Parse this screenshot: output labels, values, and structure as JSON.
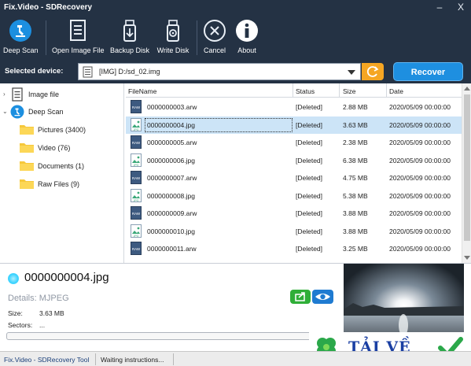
{
  "window": {
    "title": "Fix.Video - SDRecovery",
    "minimize": "–",
    "close": "X"
  },
  "toolbar": {
    "items": [
      {
        "label": "Deep Scan",
        "icon": "deep-scan-icon"
      },
      {
        "label": "Open Image File",
        "icon": "open-image-file-icon"
      },
      {
        "label": "Backup Disk",
        "icon": "backup-disk-icon"
      },
      {
        "label": "Write Disk",
        "icon": "write-disk-icon"
      },
      {
        "label": "Cancel",
        "icon": "cancel-icon"
      },
      {
        "label": "About",
        "icon": "about-icon"
      }
    ]
  },
  "device_bar": {
    "label": "Selected device:",
    "selected": "[IMG] D:/sd_02.img",
    "recover_label": "Recover"
  },
  "tree": {
    "root": [
      {
        "label": "Image file",
        "icon": "image-file-icon"
      },
      {
        "label": "Deep Scan",
        "icon": "deep-scan-icon"
      }
    ],
    "children": [
      {
        "label": "Pictures (3400)",
        "icon": "folder-icon"
      },
      {
        "label": "Video (76)",
        "icon": "folder-icon"
      },
      {
        "label": "Documents (1)",
        "icon": "folder-icon"
      },
      {
        "label": "Raw Files (9)",
        "icon": "folder-icon"
      }
    ]
  },
  "table": {
    "columns": [
      "FileName",
      "Status",
      "Size",
      "Date"
    ],
    "rows": [
      {
        "name": "0000000003.arw",
        "status": "[Deleted]",
        "size": "2.88 MB",
        "date": "2020/05/09 00:00:00",
        "type": "RAW"
      },
      {
        "name": "0000000004.jpg",
        "status": "[Deleted]",
        "size": "3.63 MB",
        "date": "2020/05/09 00:00:00",
        "type": "JPG",
        "selected": true
      },
      {
        "name": "0000000005.arw",
        "status": "[Deleted]",
        "size": "2.38 MB",
        "date": "2020/05/09 00:00:00",
        "type": "RAW"
      },
      {
        "name": "0000000006.jpg",
        "status": "[Deleted]",
        "size": "6.38 MB",
        "date": "2020/05/09 00:00:00",
        "type": "JPG"
      },
      {
        "name": "0000000007.arw",
        "status": "[Deleted]",
        "size": "4.75 MB",
        "date": "2020/05/09 00:00:00",
        "type": "RAW"
      },
      {
        "name": "0000000008.jpg",
        "status": "[Deleted]",
        "size": "5.38 MB",
        "date": "2020/05/09 00:00:00",
        "type": "JPG"
      },
      {
        "name": "0000000009.arw",
        "status": "[Deleted]",
        "size": "3.88 MB",
        "date": "2020/05/09 00:00:00",
        "type": "RAW"
      },
      {
        "name": "0000000010.jpg",
        "status": "[Deleted]",
        "size": "3.88 MB",
        "date": "2020/05/09 00:00:00",
        "type": "JPG"
      },
      {
        "name": "0000000011.arw",
        "status": "[Deleted]",
        "size": "3.25 MB",
        "date": "2020/05/09 00:00:00",
        "type": "RAW"
      }
    ]
  },
  "details": {
    "file_name": "0000000004.jpg",
    "format": "Details: MJPEG",
    "size_label": "Size:",
    "size_value": "3.63 MB",
    "sectors_label": "Sectors:",
    "sectors_value": "..."
  },
  "watermark": {
    "text": "TẢI VỀ"
  },
  "status_bar": {
    "app": "Fix.Video - SDRecovery Tool",
    "message": "Waiting instructions..."
  },
  "colors": {
    "toolbar_bg": "#243244",
    "recover_button": "#1e8fe0",
    "refresh_button": "#f5a623",
    "selection": "#cce4f7",
    "share_button": "#2fae38",
    "preview_button": "#1f7bd1"
  }
}
